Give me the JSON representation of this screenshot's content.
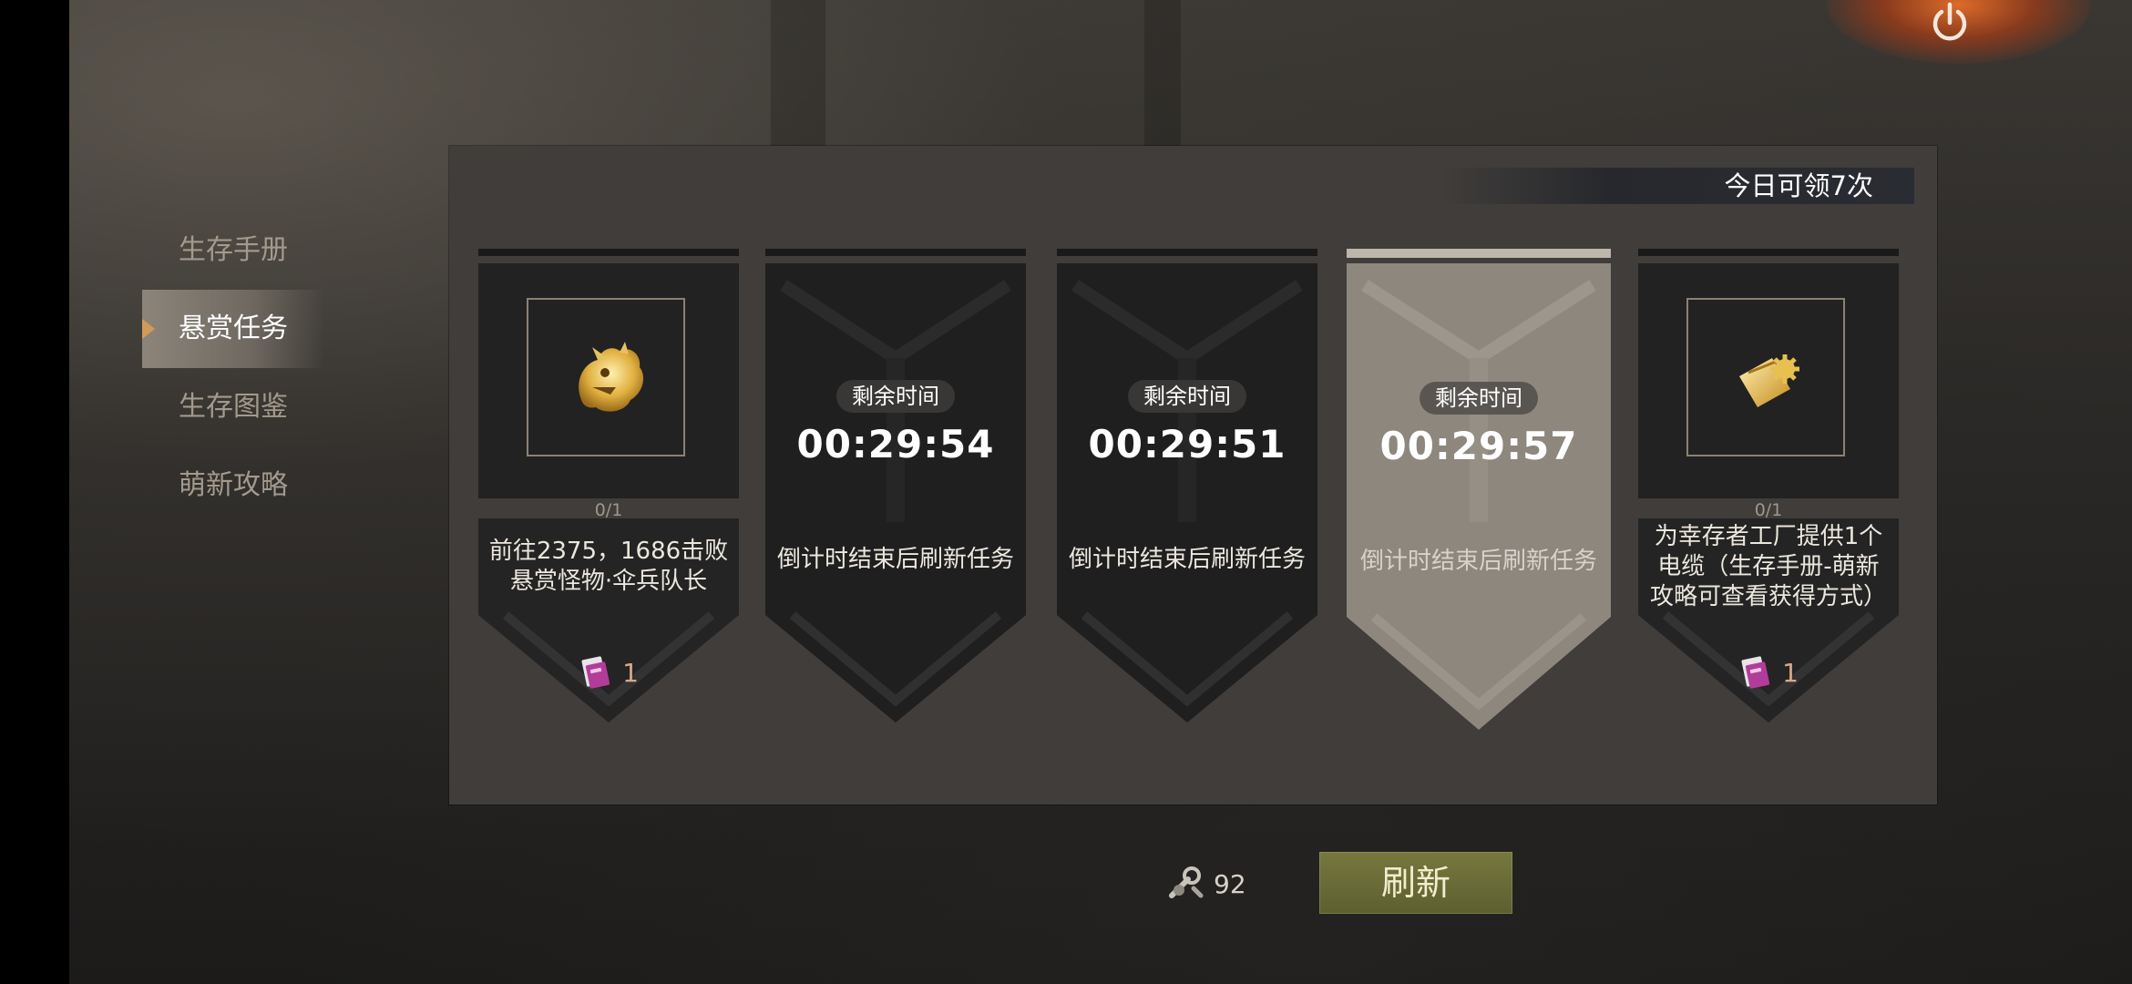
{
  "side_menu": {
    "items": [
      {
        "label": "生存手册"
      },
      {
        "label": "悬赏任务"
      },
      {
        "label": "生存图鉴"
      },
      {
        "label": "萌新攻略"
      }
    ],
    "active_index": 1
  },
  "panel": {
    "daily_claims_label": "今日可领7次"
  },
  "cards": [
    {
      "type": "task",
      "icon": "golden-squirrel-monster-icon",
      "progress": "0/1",
      "description_lines": [
        "前往2375，1686击败",
        "悬赏怪物·伞兵队长"
      ],
      "reward_icon": "bounty-ticket-icon",
      "reward_count": "1"
    },
    {
      "type": "cooldown",
      "timer_label": "剩余时间",
      "timer_value": "00:29:54",
      "note": "倒计时结束后刷新任务"
    },
    {
      "type": "cooldown",
      "timer_label": "剩余时间",
      "timer_value": "00:29:51",
      "note": "倒计时结束后刷新任务"
    },
    {
      "type": "cooldown",
      "style": "light",
      "timer_label": "剩余时间",
      "timer_value": "00:29:57",
      "note": "倒计时结束后刷新任务"
    },
    {
      "type": "task",
      "icon": "gold-gear-ticket-icon",
      "progress": "0/1",
      "description_lines": [
        "为幸存者工厂提供1个",
        "电缆（生存手册-萌新",
        "攻略可查看获得方式）"
      ],
      "reward_icon": "bounty-ticket-icon",
      "reward_count": "1"
    }
  ],
  "bottom": {
    "cost_icon": "wrench-parts-icon",
    "cost_count": "92",
    "refresh_label": "刷新"
  },
  "colors": {
    "accent_arrow": "#d29a5a",
    "refresh_button": "#6b6e36",
    "reward_count": "#d9a98a"
  }
}
